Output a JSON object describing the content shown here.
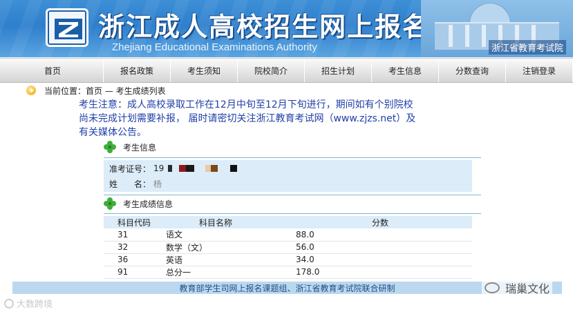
{
  "banner": {
    "title": "浙江成人高校招生网上报名",
    "subtitle": "Zhejiang Educational Examinations Authority",
    "org": "浙江省教育考试院"
  },
  "nav": {
    "items": [
      {
        "label": "首页"
      },
      {
        "label": "报名政策"
      },
      {
        "label": "考生须知"
      },
      {
        "label": "院校简介"
      },
      {
        "label": "招生计划"
      },
      {
        "label": "考生信息"
      },
      {
        "label": "分数查询"
      },
      {
        "label": "注销登录"
      }
    ]
  },
  "breadcrumb": {
    "text": "当前位置：首页 — 考生成绩列表"
  },
  "notice": {
    "text": "考生注意：成人高校录取工作在12月中旬至12月下旬进行，期间如有个别院校\n尚未完成计划需要补报， 届时请密切关注浙江教育考试网（www.zjzs.net）及\n有关媒体公告。"
  },
  "info": {
    "heading": "考生信息",
    "exam_no_label": "准考证号：",
    "exam_no_value": "19",
    "name_label": "姓　　名：",
    "name_value": "杨"
  },
  "scores": {
    "heading": "考生成绩信息",
    "columns": [
      "科目代码",
      "科目名称",
      "分数"
    ],
    "rows": [
      [
        "31",
        "语文",
        "88.0"
      ],
      [
        "32",
        "数学（文）",
        "56.0"
      ],
      [
        "36",
        "英语",
        "34.0"
      ],
      [
        "91",
        "总分一",
        "178.0"
      ]
    ]
  },
  "footer": {
    "text": "教育部学生司网上报名课题组、浙江省教育考试院联合研制"
  },
  "watermarks": {
    "left": "大数跨境",
    "right": "瑞巢文化"
  },
  "colors": {
    "banner_blue": "#2e7fcd",
    "notice_text": "#1f3fa8",
    "panel_bg": "#dcecf8",
    "footer_bg": "#bcd8ef"
  }
}
